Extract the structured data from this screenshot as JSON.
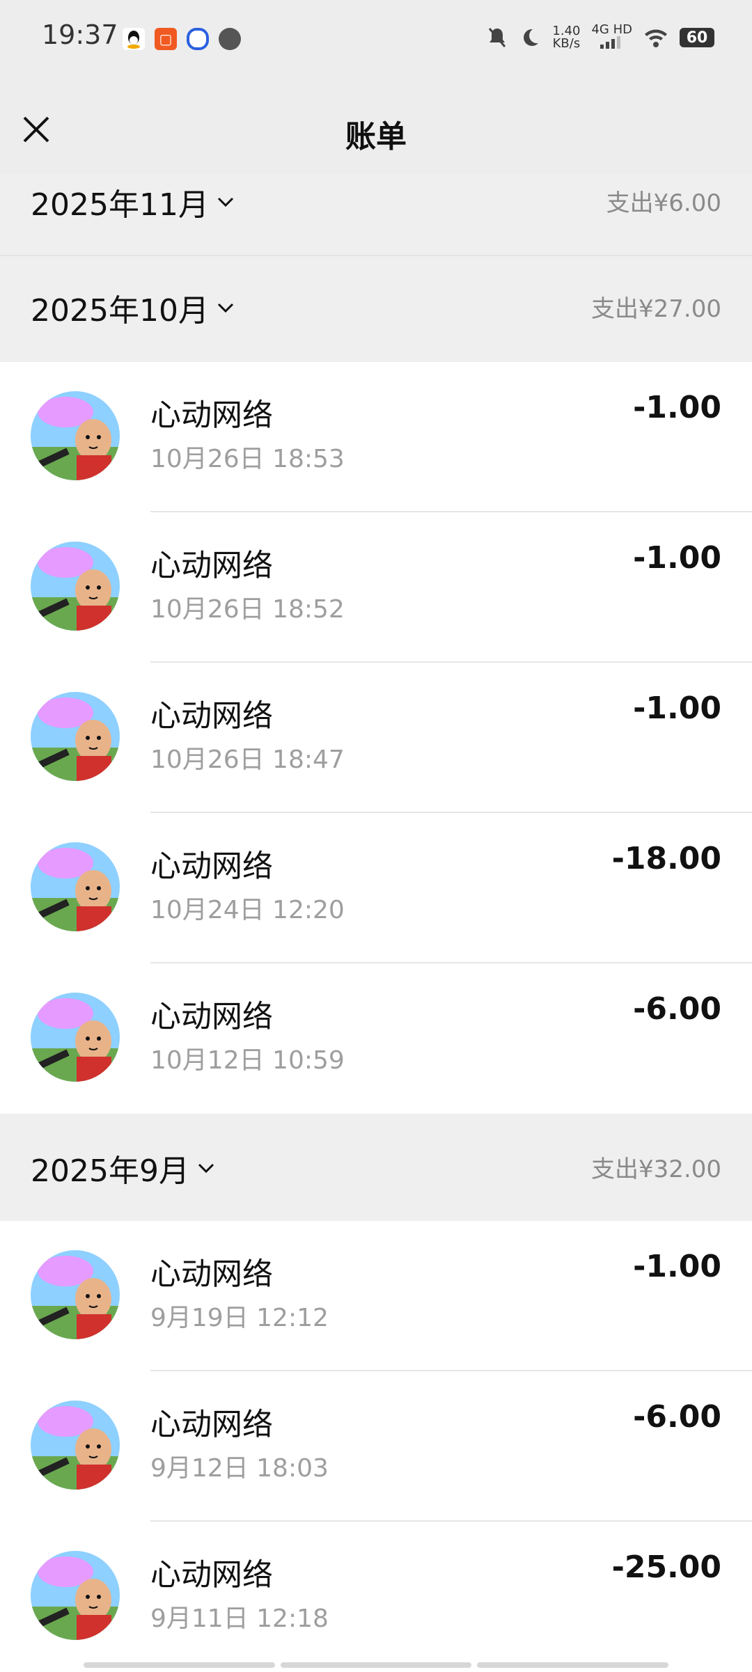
{
  "status": {
    "time": "19:37",
    "network_speed": "1.40",
    "network_unit": "KB/s",
    "network_type": "4G HD",
    "battery": "60",
    "icons": [
      "qq-icon",
      "app-icon-orange",
      "app-icon-blue",
      "message-icon",
      "mute-icon",
      "moon-icon",
      "signal-icon",
      "wifi-icon",
      "battery-icon"
    ]
  },
  "header": {
    "title": "账单"
  },
  "sections": [
    {
      "month": "2025年11月",
      "total": "支出¥6.00"
    },
    {
      "month": "2025年10月",
      "total": "支出¥27.00"
    },
    {
      "month": "2025年9月",
      "total": "支出¥32.00"
    }
  ],
  "transactions_oct": [
    {
      "name": "心动网络",
      "date": "10月26日 18:53",
      "amount": "-1.00"
    },
    {
      "name": "心动网络",
      "date": "10月26日 18:52",
      "amount": "-1.00"
    },
    {
      "name": "心动网络",
      "date": "10月26日 18:47",
      "amount": "-1.00"
    },
    {
      "name": "心动网络",
      "date": "10月24日 12:20",
      "amount": "-18.00"
    },
    {
      "name": "心动网络",
      "date": "10月12日 10:59",
      "amount": "-6.00"
    }
  ],
  "transactions_sep": [
    {
      "name": "心动网络",
      "date": "9月19日 12:12",
      "amount": "-1.00"
    },
    {
      "name": "心动网络",
      "date": "9月12日 18:03",
      "amount": "-6.00"
    },
    {
      "name": "心动网络",
      "date": "9月11日 12:18",
      "amount": "-25.00"
    }
  ],
  "colors": {
    "background": "#ffffff",
    "section_bg": "#efefef",
    "secondary_text": "#9e9e9e"
  }
}
